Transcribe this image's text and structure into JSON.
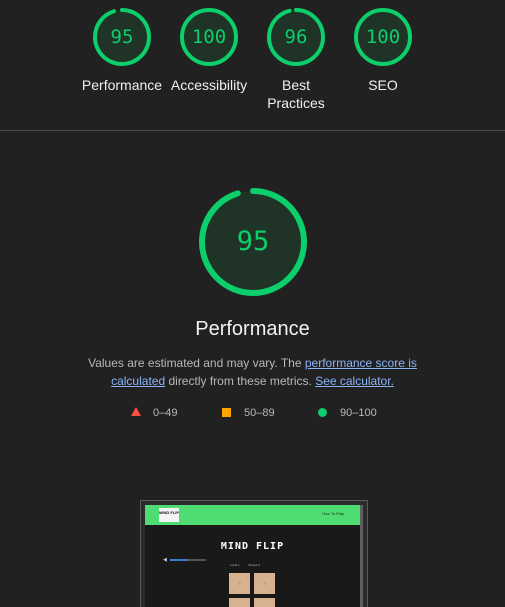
{
  "categories": [
    {
      "name": "Performance",
      "score": "95",
      "value": 0.95
    },
    {
      "name": "Accessibility",
      "score": "100",
      "value": 1.0
    },
    {
      "name": "Best Practices",
      "score": "96",
      "value": 0.96
    },
    {
      "name": "SEO",
      "score": "100",
      "value": 1.0
    }
  ],
  "main": {
    "score": "95",
    "value": 0.95,
    "title": "Performance",
    "desc_prefix": "Values are estimated and may vary. The ",
    "desc_link1": "performance score is calculated",
    "desc_middle": " directly from these metrics. ",
    "desc_link2": "See calculator."
  },
  "legend": [
    {
      "shape": "triangle",
      "label": "0–49",
      "color": "#ff4e42"
    },
    {
      "shape": "square",
      "label": "50–89",
      "color": "#ffa400"
    },
    {
      "shape": "circle",
      "label": "90–100",
      "color": "#0cce6b"
    }
  ],
  "colors": {
    "pass": "#0cce6b",
    "background": "#212121"
  },
  "screenshot": {
    "logo": "MIND FLIP",
    "nav_link": "How To Play",
    "title": "MIND FLIP",
    "speaker_icon": "speaker-icon",
    "volume": 0.5,
    "stats": [
      "Level 1",
      "Moves 0"
    ],
    "card_glyph": "?"
  }
}
